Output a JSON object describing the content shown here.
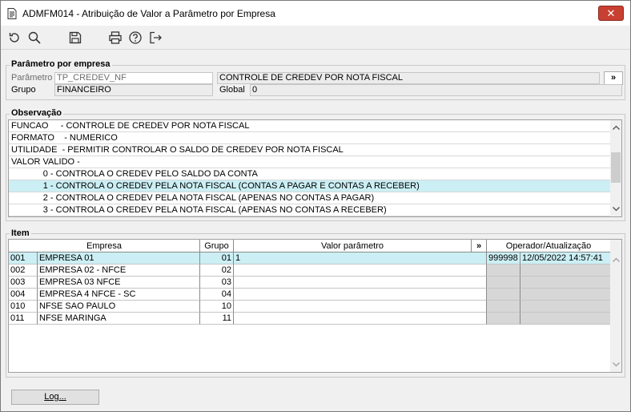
{
  "window": {
    "title": "ADMFM014 - Atribuição de Valor a Parâmetro por Empresa",
    "close_label": "✕"
  },
  "toolbar": {
    "icons": [
      "refresh-icon",
      "search-icon",
      "save-icon",
      "print-icon",
      "help-icon",
      "exit-icon"
    ]
  },
  "param_group": {
    "title": "Parâmetro por empresa",
    "parametro_label": "Parâmetro",
    "parametro_value": "TP_CREDEV_NF",
    "descricao_value": "CONTROLE DE CREDEV POR NOTA FISCAL",
    "expand_label": "»",
    "grupo_label": "Grupo",
    "grupo_value": "FINANCEIRO",
    "global_label": "Global",
    "global_value": "0"
  },
  "obs_group": {
    "title": "Observação",
    "lines": [
      "FUNCAO     - CONTROLE DE CREDEV POR NOTA FISCAL",
      "FORMATO    - NUMERICO",
      "UTILIDADE  - PERMITIR CONTROLAR O SALDO DE CREDEV POR NOTA FISCAL",
      "VALOR VALIDO -",
      "             0 - CONTROLA O CREDEV PELO SALDO DA CONTA",
      "             1 - CONTROLA O CREDEV PELA NOTA FISCAL (CONTAS A PAGAR E CONTAS A RECEBER)",
      "             2 - CONTROLA O CREDEV PELA NOTA FISCAL (APENAS NO CONTAS A PAGAR)",
      "             3 - CONTROLA O CREDEV PELA NOTA FISCAL (APENAS NO CONTAS A RECEBER)"
    ]
  },
  "item_group": {
    "title": "Item",
    "headers": {
      "empresa": "Empresa",
      "grupo": "Grupo",
      "valor": "Valor parâmetro",
      "expand": "»",
      "operador": "Operador/Atualização"
    },
    "rows": [
      {
        "code": "001",
        "name": "EMPRESA 01",
        "grupo": "01",
        "valor": "1",
        "operador": "999998",
        "atualizacao": "12/05/2022 14:57:41"
      },
      {
        "code": "002",
        "name": "EMPRESA 02 - NFCE",
        "grupo": "02",
        "valor": "",
        "operador": "",
        "atualizacao": ""
      },
      {
        "code": "003",
        "name": "EMPRESA 03 NFCE",
        "grupo": "03",
        "valor": "",
        "operador": "",
        "atualizacao": ""
      },
      {
        "code": "004",
        "name": "EMPRESA 4 NFCE - SC",
        "grupo": "04",
        "valor": "",
        "operador": "",
        "atualizacao": ""
      },
      {
        "code": "010",
        "name": "NFSE SAO PAULO",
        "grupo": "10",
        "valor": "",
        "operador": "",
        "atualizacao": ""
      },
      {
        "code": "011",
        "name": "NFSE MARINGA",
        "grupo": "11",
        "valor": "",
        "operador": "",
        "atualizacao": ""
      }
    ]
  },
  "footer": {
    "log_label": "Log..."
  }
}
